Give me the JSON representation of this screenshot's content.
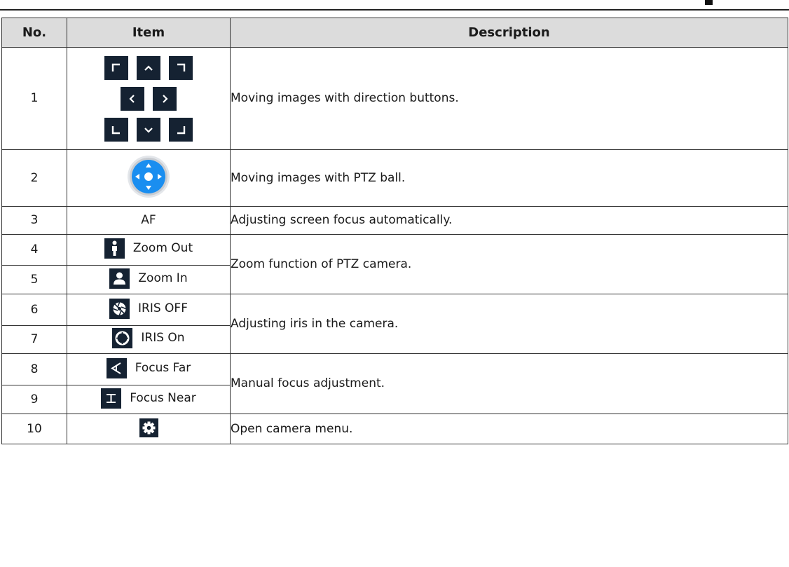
{
  "headers": {
    "no": "No.",
    "item": "Item",
    "description": "Description"
  },
  "rows": [
    {
      "no": "1",
      "description": "Moving images with direction buttons."
    },
    {
      "no": "2",
      "description": "Moving images with PTZ ball."
    },
    {
      "no": "3",
      "item": "AF",
      "description": "Adjusting screen focus automatically."
    },
    {
      "no": "4",
      "item": "Zoom Out",
      "description": "Zoom function of PTZ camera."
    },
    {
      "no": "5",
      "item": "Zoom In"
    },
    {
      "no": "6",
      "item": "IRIS OFF",
      "description": "Adjusting iris in the camera."
    },
    {
      "no": "7",
      "item": "IRIS On"
    },
    {
      "no": "8",
      "item": "Focus Far",
      "description": "Manual focus adjustment."
    },
    {
      "no": "9",
      "item": "Focus Near"
    },
    {
      "no": "10",
      "description": "Open camera menu."
    }
  ],
  "icons": {
    "direction_buttons": [
      "up-left-icon",
      "up-icon",
      "up-right-icon",
      "left-icon",
      "right-icon",
      "down-left-icon",
      "down-icon",
      "down-right-icon"
    ],
    "ptz_ball": "ptz-ball-icon",
    "zoom_out": "person-full-icon",
    "zoom_in": "person-bust-icon",
    "iris_off": "aperture-closed-icon",
    "iris_on": "aperture-open-icon",
    "focus_far": "focus-far-icon",
    "focus_near": "focus-near-icon",
    "camera_menu": "gear-icon"
  },
  "colors": {
    "icon_bg": "#152232",
    "ball_blue": "#1a8ef0",
    "header_bg": "#dcdcdc"
  }
}
